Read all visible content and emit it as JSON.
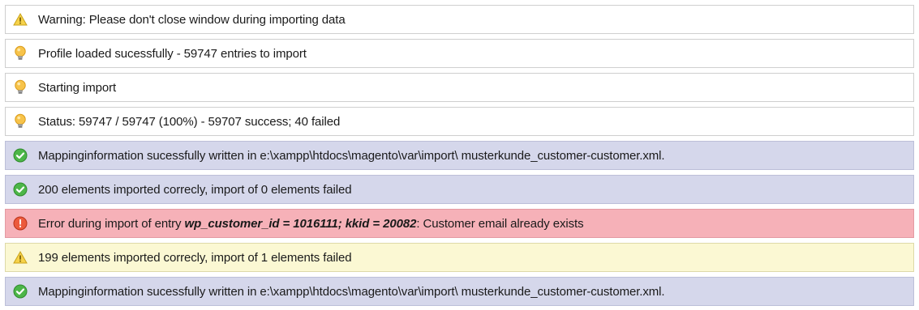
{
  "messages": [
    {
      "type": "warning-plain",
      "icon": "warning-icon",
      "text": "Warning: Please don't close window during importing data"
    },
    {
      "type": "notice",
      "icon": "lightbulb-icon",
      "text": "Profile loaded sucessfully - 59747 entries to import"
    },
    {
      "type": "notice",
      "icon": "lightbulb-icon",
      "text": "Starting import"
    },
    {
      "type": "notice",
      "icon": "lightbulb-icon",
      "text": "Status: 59747 / 59747 (100%) - 59707 success; 40 failed"
    },
    {
      "type": "success",
      "icon": "check-circle-icon",
      "text": "Mappinginformation sucessfully written in e:\\xampp\\htdocs\\magento\\var\\import\\ musterkunde_customer-customer.xml."
    },
    {
      "type": "success",
      "icon": "check-circle-icon",
      "text": "200 elements imported correcly, import of 0 elements failed"
    },
    {
      "type": "error",
      "icon": "error-circle-icon",
      "prefix": "Error during import of entry ",
      "emphasis": "wp_customer_id = 1016111; kkid = 20082",
      "suffix": ": Customer email already exists"
    },
    {
      "type": "warning",
      "icon": "warning-icon",
      "text": "199 elements imported correcly, import of 1 elements failed"
    },
    {
      "type": "success",
      "icon": "check-circle-icon",
      "text": "Mappinginformation sucessfully written in e:\\xampp\\htdocs\\magento\\var\\import\\ musterkunde_customer-customer.xml."
    }
  ],
  "colors": {
    "notice_bg": "#ffffff",
    "success_bg": "#d5d7eb",
    "error_bg": "#f6b1b8",
    "warning_bg": "#fbf8d3",
    "check_icon": "#3fae3a",
    "error_icon": "#e8432a",
    "warning_icon": "#f1c232",
    "bulb_icon": "#f2b32a"
  }
}
